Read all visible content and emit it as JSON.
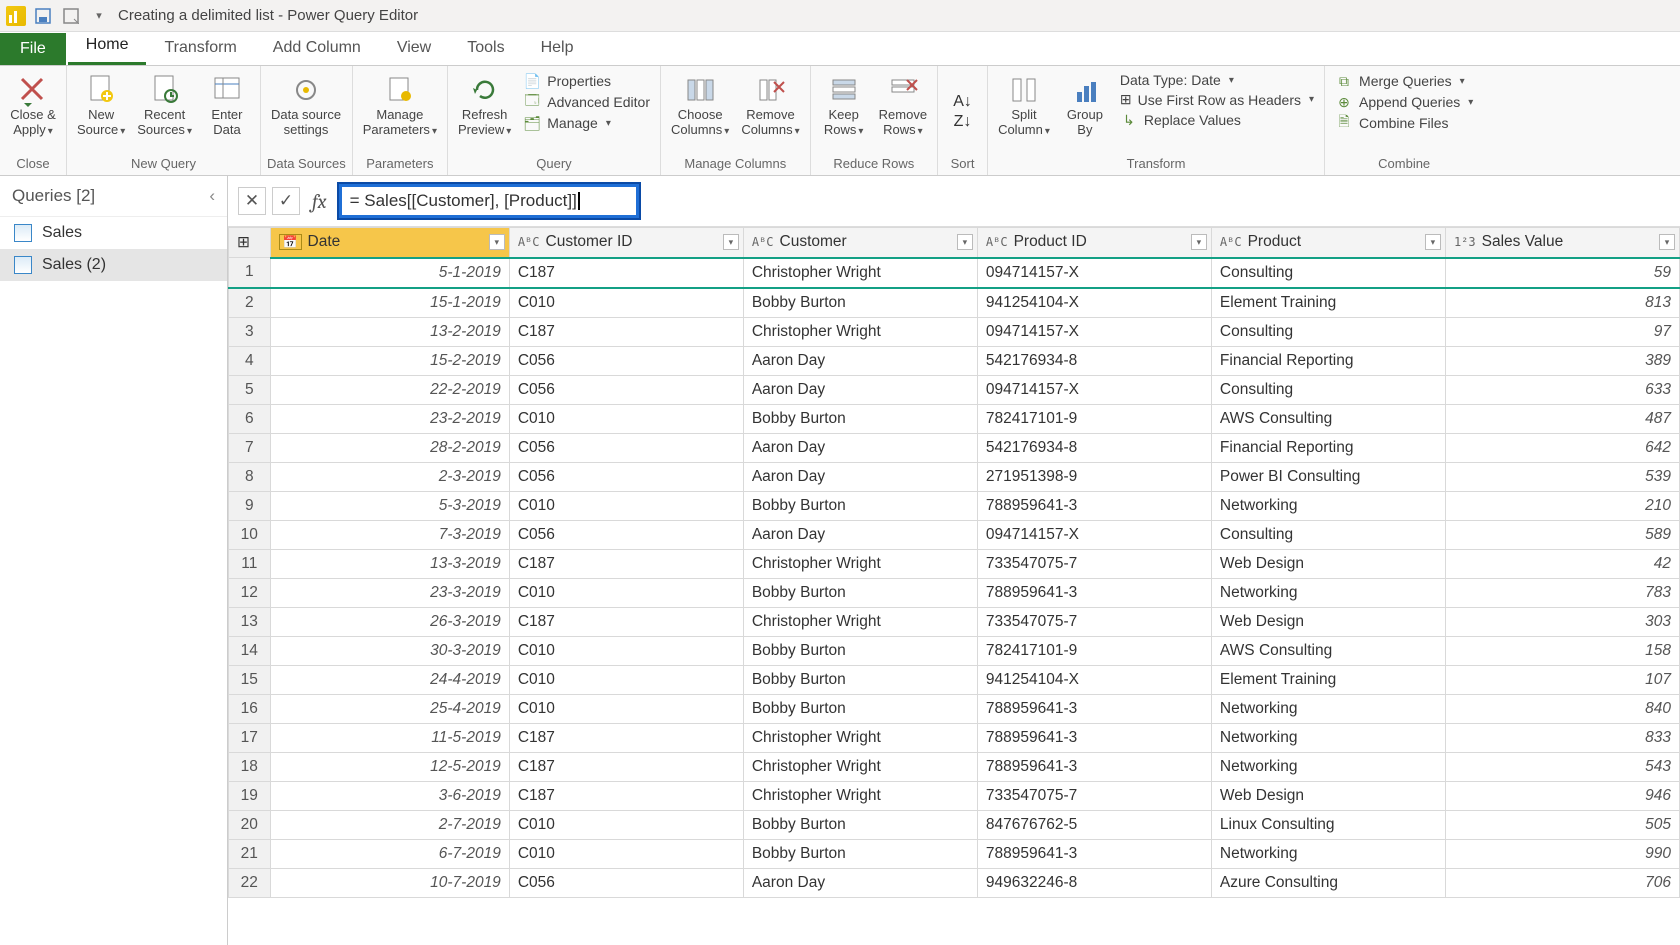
{
  "window": {
    "title": "Creating a delimited list - Power Query Editor"
  },
  "tabs": {
    "file": "File",
    "home": "Home",
    "transform": "Transform",
    "addcolumn": "Add Column",
    "view": "View",
    "tools": "Tools",
    "help": "Help"
  },
  "ribbon": {
    "close": {
      "close_apply": "Close &\nApply",
      "group": "Close"
    },
    "newquery": {
      "new_source": "New\nSource",
      "recent_sources": "Recent\nSources",
      "enter_data": "Enter\nData",
      "group": "New Query"
    },
    "datasources": {
      "settings": "Data source\nsettings",
      "group": "Data Sources"
    },
    "parameters": {
      "manage": "Manage\nParameters",
      "group": "Parameters"
    },
    "query": {
      "refresh": "Refresh\nPreview",
      "properties": "Properties",
      "adv_editor": "Advanced Editor",
      "manage": "Manage",
      "group": "Query"
    },
    "managecols": {
      "choose": "Choose\nColumns",
      "remove": "Remove\nColumns",
      "group": "Manage Columns"
    },
    "reducerows": {
      "keep": "Keep\nRows",
      "remove": "Remove\nRows",
      "group": "Reduce Rows"
    },
    "sort": {
      "group": "Sort"
    },
    "transform": {
      "split": "Split\nColumn",
      "groupby": "Group\nBy",
      "datatype": "Data Type: Date",
      "firstrow": "Use First Row as Headers",
      "replace": "Replace Values",
      "group": "Transform"
    },
    "combine": {
      "merge": "Merge Queries",
      "append": "Append Queries",
      "combine": "Combine Files",
      "group": "Combine"
    }
  },
  "queries": {
    "header": "Queries [2]",
    "items": [
      "Sales",
      "Sales (2)"
    ],
    "selected": 1
  },
  "formula": "= Sales[[Customer], [Product]]",
  "columns": [
    {
      "name": "Date",
      "type": "date",
      "selected": true,
      "typeicon": "📅"
    },
    {
      "name": "Customer ID",
      "type": "text",
      "typeicon": "AᴮC"
    },
    {
      "name": "Customer",
      "type": "text",
      "typeicon": "AᴮC"
    },
    {
      "name": "Product ID",
      "type": "text",
      "typeicon": "AᴮC"
    },
    {
      "name": "Product",
      "type": "text",
      "typeicon": "AᴮC"
    },
    {
      "name": "Sales Value",
      "type": "number",
      "typeicon": "1²3"
    }
  ],
  "rows": [
    {
      "n": 1,
      "date": "5-1-2019",
      "cid": "C187",
      "cust": "Christopher Wright",
      "pid": "094714157-X",
      "prod": "Consulting",
      "val": "59"
    },
    {
      "n": 2,
      "date": "15-1-2019",
      "cid": "C010",
      "cust": "Bobby Burton",
      "pid": "941254104-X",
      "prod": "Element Training",
      "val": "813"
    },
    {
      "n": 3,
      "date": "13-2-2019",
      "cid": "C187",
      "cust": "Christopher Wright",
      "pid": "094714157-X",
      "prod": "Consulting",
      "val": "97"
    },
    {
      "n": 4,
      "date": "15-2-2019",
      "cid": "C056",
      "cust": "Aaron Day",
      "pid": "542176934-8",
      "prod": "Financial Reporting",
      "val": "389"
    },
    {
      "n": 5,
      "date": "22-2-2019",
      "cid": "C056",
      "cust": "Aaron Day",
      "pid": "094714157-X",
      "prod": "Consulting",
      "val": "633"
    },
    {
      "n": 6,
      "date": "23-2-2019",
      "cid": "C010",
      "cust": "Bobby Burton",
      "pid": "782417101-9",
      "prod": "AWS Consulting",
      "val": "487"
    },
    {
      "n": 7,
      "date": "28-2-2019",
      "cid": "C056",
      "cust": "Aaron Day",
      "pid": "542176934-8",
      "prod": "Financial Reporting",
      "val": "642"
    },
    {
      "n": 8,
      "date": "2-3-2019",
      "cid": "C056",
      "cust": "Aaron Day",
      "pid": "271951398-9",
      "prod": "Power BI Consulting",
      "val": "539"
    },
    {
      "n": 9,
      "date": "5-3-2019",
      "cid": "C010",
      "cust": "Bobby Burton",
      "pid": "788959641-3",
      "prod": "Networking",
      "val": "210"
    },
    {
      "n": 10,
      "date": "7-3-2019",
      "cid": "C056",
      "cust": "Aaron Day",
      "pid": "094714157-X",
      "prod": "Consulting",
      "val": "589"
    },
    {
      "n": 11,
      "date": "13-3-2019",
      "cid": "C187",
      "cust": "Christopher Wright",
      "pid": "733547075-7",
      "prod": "Web Design",
      "val": "42"
    },
    {
      "n": 12,
      "date": "23-3-2019",
      "cid": "C010",
      "cust": "Bobby Burton",
      "pid": "788959641-3",
      "prod": "Networking",
      "val": "783"
    },
    {
      "n": 13,
      "date": "26-3-2019",
      "cid": "C187",
      "cust": "Christopher Wright",
      "pid": "733547075-7",
      "prod": "Web Design",
      "val": "303"
    },
    {
      "n": 14,
      "date": "30-3-2019",
      "cid": "C010",
      "cust": "Bobby Burton",
      "pid": "782417101-9",
      "prod": "AWS Consulting",
      "val": "158"
    },
    {
      "n": 15,
      "date": "24-4-2019",
      "cid": "C010",
      "cust": "Bobby Burton",
      "pid": "941254104-X",
      "prod": "Element Training",
      "val": "107"
    },
    {
      "n": 16,
      "date": "25-4-2019",
      "cid": "C010",
      "cust": "Bobby Burton",
      "pid": "788959641-3",
      "prod": "Networking",
      "val": "840"
    },
    {
      "n": 17,
      "date": "11-5-2019",
      "cid": "C187",
      "cust": "Christopher Wright",
      "pid": "788959641-3",
      "prod": "Networking",
      "val": "833"
    },
    {
      "n": 18,
      "date": "12-5-2019",
      "cid": "C187",
      "cust": "Christopher Wright",
      "pid": "788959641-3",
      "prod": "Networking",
      "val": "543"
    },
    {
      "n": 19,
      "date": "3-6-2019",
      "cid": "C187",
      "cust": "Christopher Wright",
      "pid": "733547075-7",
      "prod": "Web Design",
      "val": "946"
    },
    {
      "n": 20,
      "date": "2-7-2019",
      "cid": "C010",
      "cust": "Bobby Burton",
      "pid": "847676762-5",
      "prod": "Linux Consulting",
      "val": "505"
    },
    {
      "n": 21,
      "date": "6-7-2019",
      "cid": "C010",
      "cust": "Bobby Burton",
      "pid": "788959641-3",
      "prod": "Networking",
      "val": "990"
    },
    {
      "n": 22,
      "date": "10-7-2019",
      "cid": "C056",
      "cust": "Aaron Day",
      "pid": "949632246-8",
      "prod": "Azure Consulting",
      "val": "706"
    }
  ]
}
